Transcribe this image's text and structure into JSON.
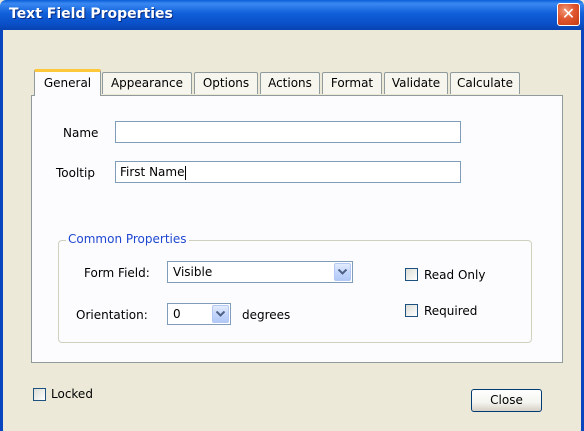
{
  "window": {
    "title": "Text Field Properties",
    "close_glyph": "✕"
  },
  "tabs": [
    {
      "label": "General",
      "active": true
    },
    {
      "label": "Appearance"
    },
    {
      "label": "Options"
    },
    {
      "label": "Actions"
    },
    {
      "label": "Format"
    },
    {
      "label": "Validate"
    },
    {
      "label": "Calculate"
    }
  ],
  "general": {
    "name_label": "Name",
    "name_value": "",
    "tooltip_label": "Tooltip",
    "tooltip_value": "First Name"
  },
  "common": {
    "group_label": "Common Properties",
    "form_field_label": "Form Field:",
    "form_field_value": "Visible",
    "orientation_label": "Orientation:",
    "orientation_value": "0",
    "degrees_label": "degrees",
    "read_only_label": "Read Only",
    "read_only_checked": false,
    "required_label": "Required",
    "required_checked": false
  },
  "footer": {
    "locked_label": "Locked",
    "locked_checked": false,
    "close_label": "Close"
  },
  "colors": {
    "accent": "#0A5FD8",
    "group_label": "#1F48D0",
    "tab_highlight": "#FFC83C"
  }
}
